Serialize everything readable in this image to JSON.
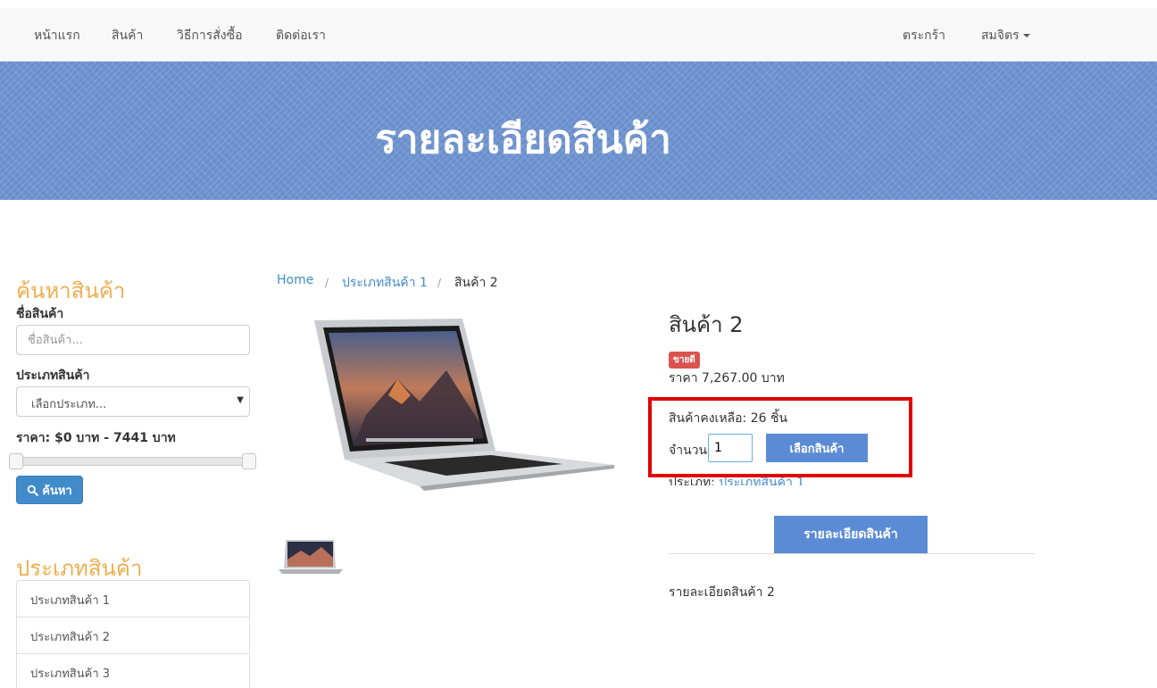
{
  "nav": {
    "home": "หน้าแรก",
    "products": "สินค้า",
    "how_to_order": "วิธีการสั่งซื้อ",
    "contact": "ติดต่อเรา",
    "cart": "ตระกร้า",
    "user": "สมจิตร"
  },
  "hero": {
    "title": "รายละเอียดสินค้า"
  },
  "sidebar": {
    "search_heading": "ค้นหาสินค้า",
    "name_label": "ชื่อสินค้า",
    "name_placeholder": "ชื่อสินค้า...",
    "type_label": "ประเภทสินค้า",
    "type_selected": "เลือกประเภท...",
    "price_label": "ราคา: $0 บาท - 7441 บาท",
    "search_button": "ค้นหา",
    "category_heading": "ประเภทสินค้า",
    "categories": [
      "ประเภทสินค้า 1",
      "ประเภทสินค้า 2",
      "ประเภทสินค้า 3"
    ]
  },
  "breadcrumb": {
    "home": "Home",
    "sep": "/",
    "category": "ประเภทสินค้า 1",
    "current": "สินค้า 2"
  },
  "product": {
    "name": "สินค้า 2",
    "badge": "ขายดี",
    "price": "ราคา 7,267.00 บาท",
    "stock": "สินค้าคงเหลือ: 26 ชิ้น",
    "qty_label": "จำนวน",
    "qty_value": "1",
    "select_button": "เลือกสินค้า",
    "type_label": "ประเภท: ",
    "type_value": "ประเภทสินค้า 1",
    "tab_label": "รายละเอียดสินค้า",
    "description": "รายละเอียดสินค้า 2"
  },
  "colors": {
    "accent": "#5b8bd4",
    "hero_bg": "#6f95d3",
    "heading_orange": "#f0ad4e",
    "highlight_red": "#e00000",
    "badge_red": "#d9534f"
  }
}
